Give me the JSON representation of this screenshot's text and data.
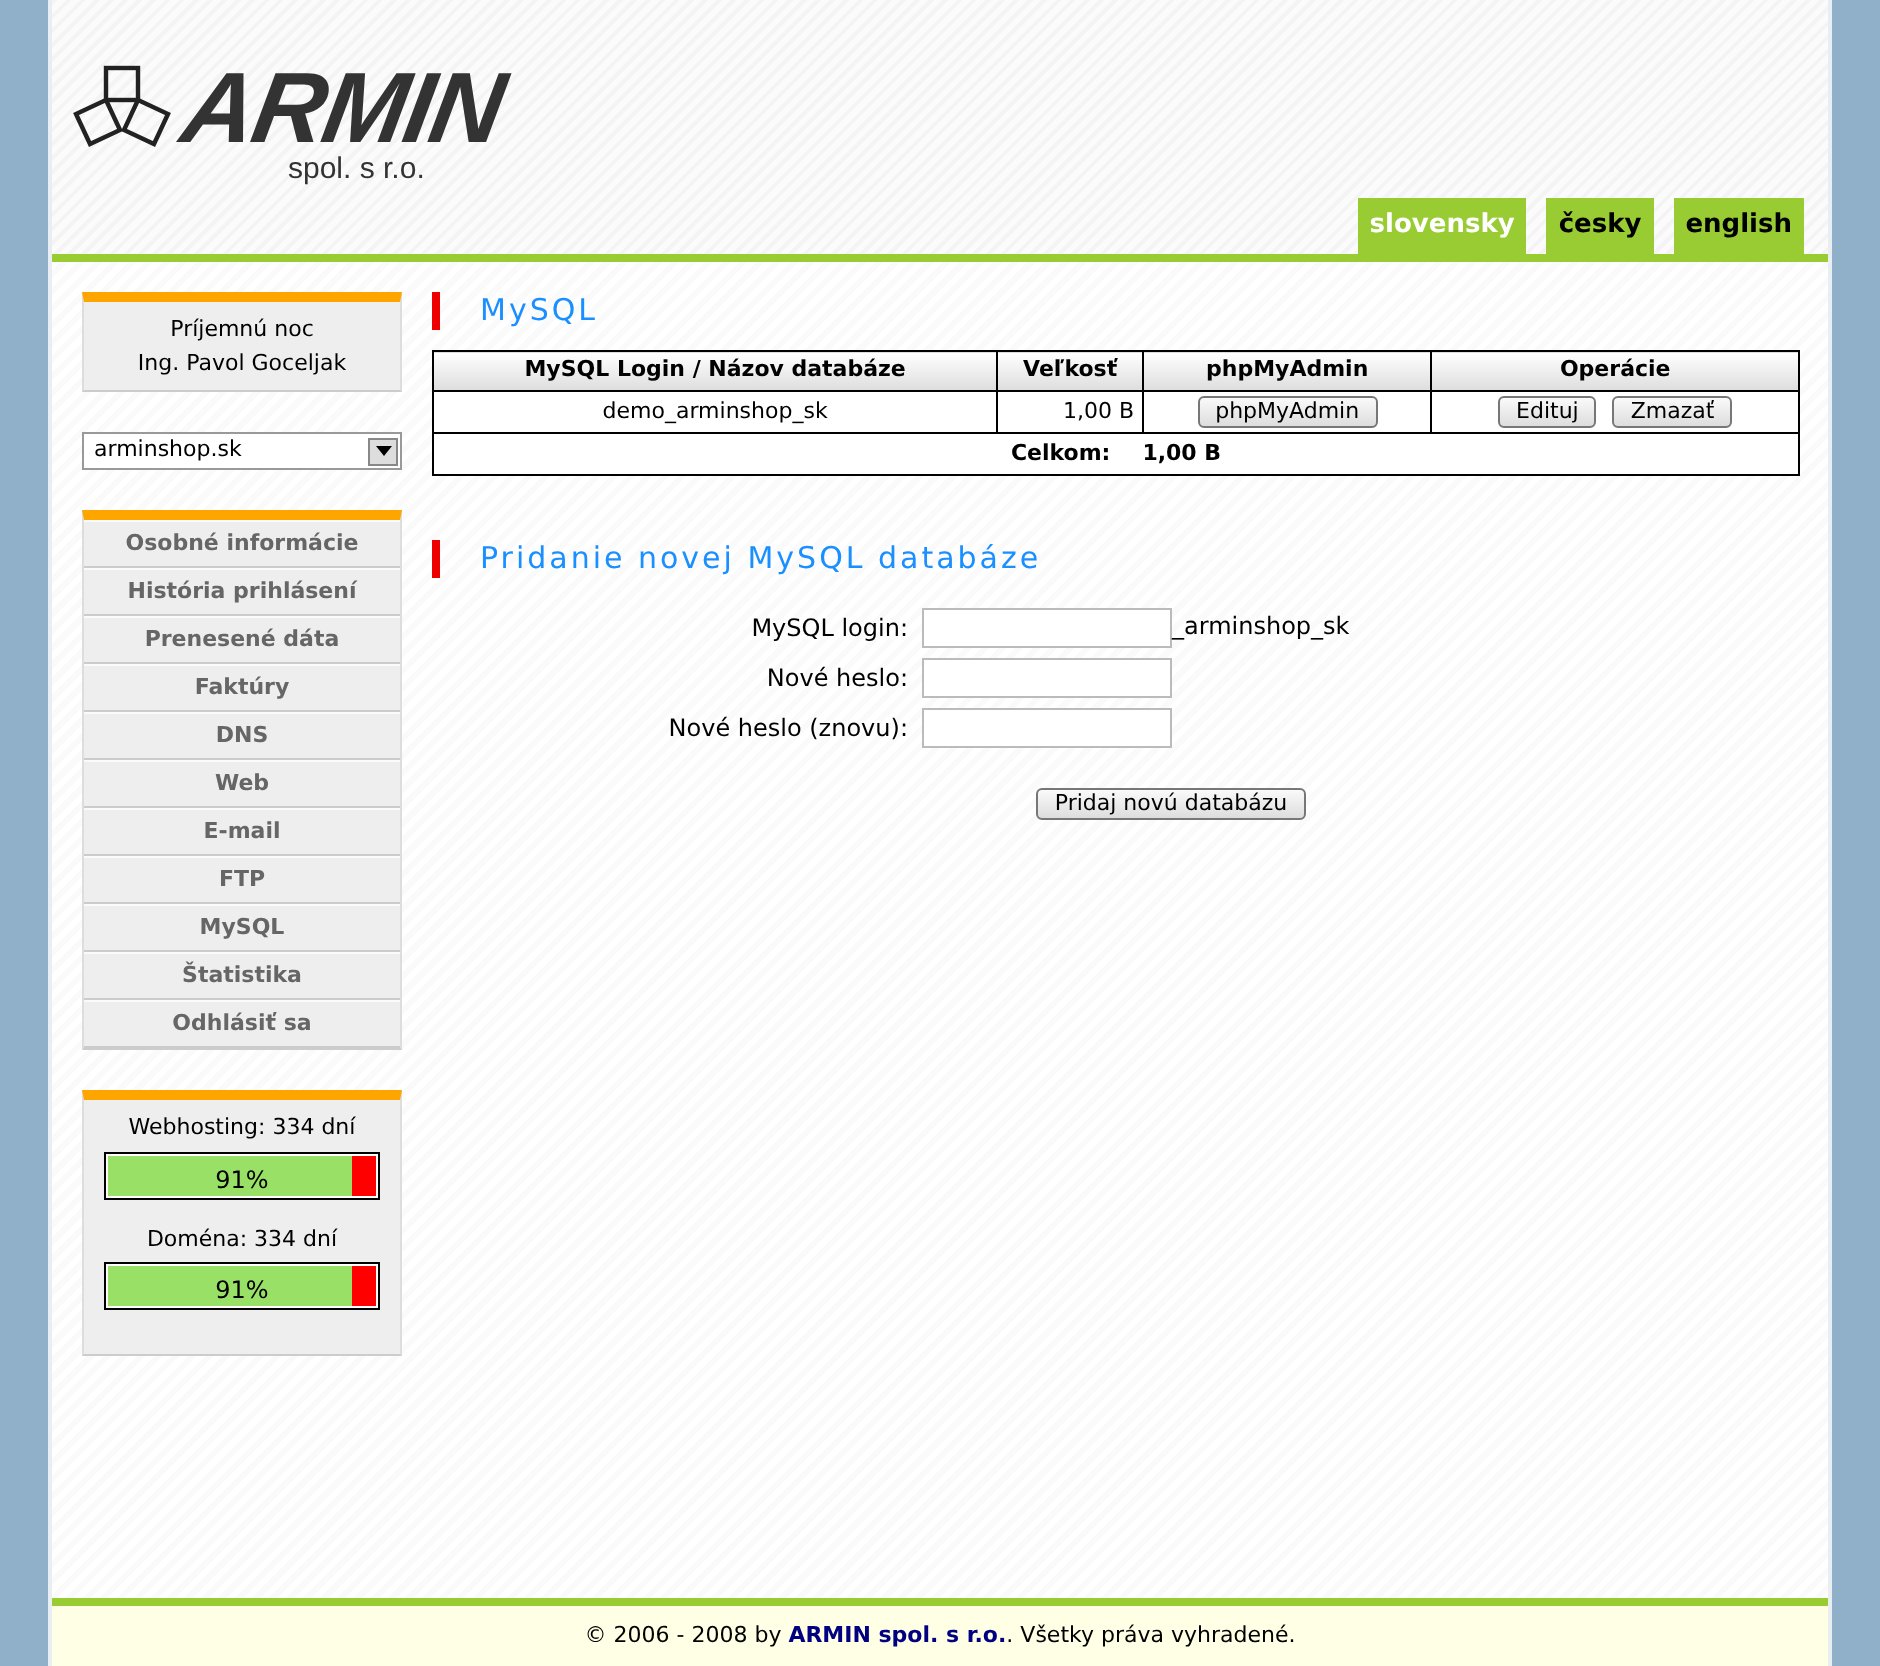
{
  "logo": {
    "name": "ARMIN",
    "subtitle": "spol. s r.o."
  },
  "languages": [
    {
      "label": "slovensky",
      "selected": true
    },
    {
      "label": "česky",
      "selected": false
    },
    {
      "label": "english",
      "selected": false
    }
  ],
  "sidebar": {
    "greeting": [
      "Príjemnú noc",
      "Ing. Pavol Goceljak"
    ],
    "domain_select": {
      "value": "arminshop.sk"
    },
    "menu": [
      "Osobné informácie",
      "História prihlásení",
      "Prenesené dáta",
      "Faktúry",
      "DNS",
      "Web",
      "E-mail",
      "FTP",
      "MySQL",
      "Štatistika",
      "Odhlásiť sa"
    ],
    "expiry": [
      {
        "label": "Webhosting: 334 dní",
        "level": 0.91,
        "reading": "91%"
      },
      {
        "label": "Doména: 334 dní",
        "level": 0.91,
        "reading": "91%"
      }
    ]
  },
  "mysql_section": {
    "title": "MySQL",
    "table": {
      "columns": [
        "MySQL Login / Názov databáze",
        "Veľkosť",
        "phpMyAdmin",
        "Operácie"
      ],
      "rows": [
        {
          "name": "demo_arminshop_sk",
          "size": "1,00 B",
          "admin_button": "phpMyAdmin",
          "actions": [
            "Edituj",
            "Zmazať"
          ]
        }
      ],
      "total_label": "Celkom:",
      "total_value": "1,00 B"
    }
  },
  "add_section": {
    "title": "Pridanie novej MySQL databáze",
    "fields": [
      {
        "label": "MySQL login:",
        "suffix": "_arminshop_sk"
      },
      {
        "label": "Nové heslo:"
      },
      {
        "label": "Nové heslo (znovu):"
      }
    ],
    "submit": "Pridaj novú databázu"
  },
  "footer": {
    "before": "© 2006 - 2008 by",
    "link": "ARMIN spol. s r.o.",
    "after": ". Všetky práva vyhradené."
  }
}
